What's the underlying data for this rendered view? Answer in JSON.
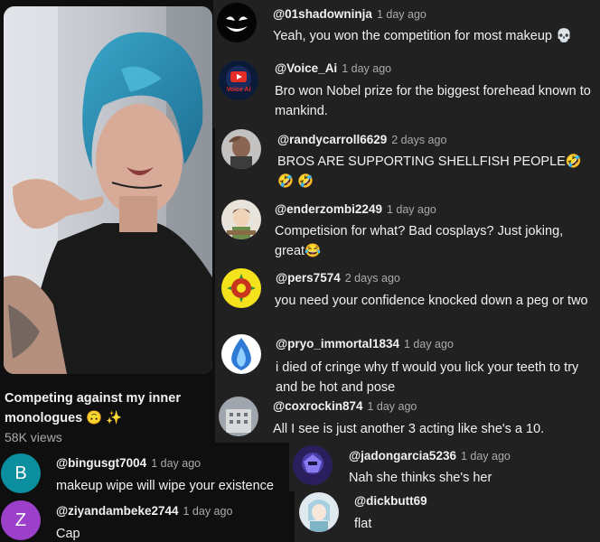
{
  "video": {
    "title_line1": "Competing against my inner",
    "title_line2": "monologues 🙃 ✨",
    "views": "58K views"
  },
  "comments": [
    {
      "handle": "@01shadowninja",
      "time": "1 day ago",
      "text": "Yeah, you won the competition for most makeup 💀"
    },
    {
      "handle": "@Voice_Ai",
      "time": "1 day ago",
      "text": "Bro won Nobel prize for the biggest forehead known to mankind.",
      "avatar_label": "Voice Ai"
    },
    {
      "handle": "@randycarroll6629",
      "time": "2 days ago",
      "text": "BROS ARE SUPPORTING SHELLFISH PEOPLE🤣 🤣 🤣"
    },
    {
      "handle": "@enderzombi2249",
      "time": "1 day ago",
      "text": "Competision for what? Bad cosplays? Just joking, great😂"
    },
    {
      "handle": "@pers7574",
      "time": "2 days ago",
      "text": "you need your confidence knocked down a peg or two"
    },
    {
      "handle": "@pryo_immortal1834",
      "time": "1 day ago",
      "text": "i died of cringe why tf would you lick your teeth to try and be hot and pose"
    },
    {
      "handle": "@coxrockin874",
      "time": "1 day ago",
      "text": "All I see is just another 3 acting like she's a 10."
    },
    {
      "handle": "@jadongarcia5236",
      "time": "1 day ago",
      "text": "Nah she thinks she's her"
    },
    {
      "handle": "@dickbutt69",
      "time": "",
      "text": "flat"
    },
    {
      "handle": "@bingusgt7004",
      "time": "1 day ago",
      "text": "makeup wipe will wipe your existence",
      "avatar_letter": "B"
    },
    {
      "handle": "@ziyandambeke2744",
      "time": "1 day ago",
      "text": "Cap",
      "avatar_letter": "Z"
    }
  ],
  "colors": {
    "page_bg": "#0f0f0f",
    "panel_bg": "#212121",
    "text_primary": "#f1f1f1",
    "text_secondary": "#aaaaaa",
    "avatar_b": "#0b8f9e",
    "avatar_z": "#9c3fc9"
  }
}
